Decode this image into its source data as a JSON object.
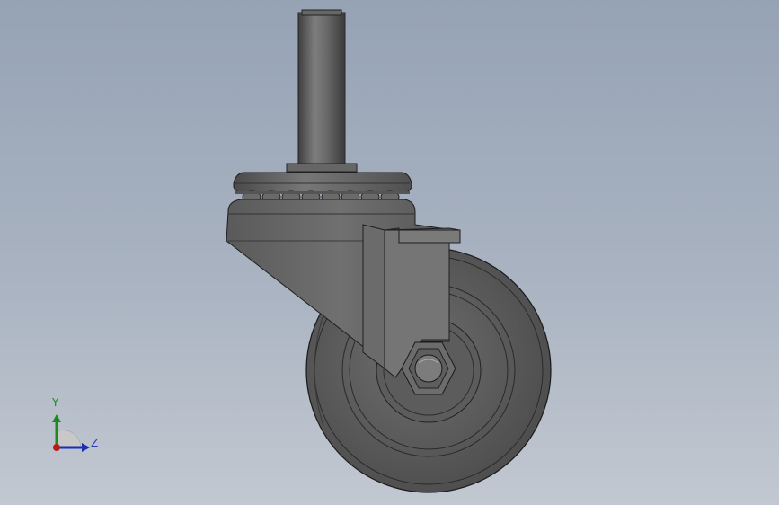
{
  "viewport": {
    "background_top": "#96a3b5",
    "background_bottom": "#c2c8d1"
  },
  "model": {
    "part_color": "#5e5e5e",
    "edge_color": "#1e1e1e",
    "highlight_color": "#8a8a8a"
  },
  "triad": {
    "y_label": "Y",
    "z_label": "Z",
    "y_color": "#1e8a1e",
    "z_color": "#1a2fb8",
    "x_color": "#c01818",
    "label_color": "#2a3fb8"
  }
}
